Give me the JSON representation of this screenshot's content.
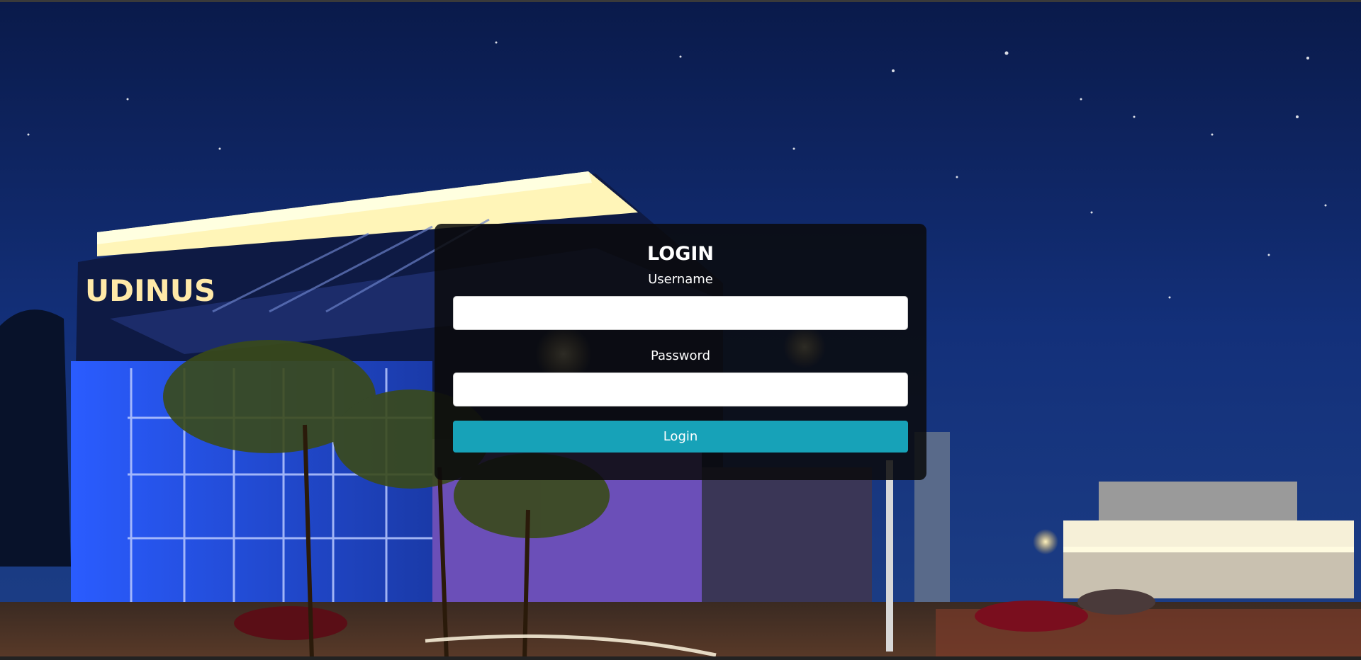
{
  "background": {
    "sky_color": "#0b1f55",
    "building_sign": "UDINUS"
  },
  "login": {
    "title": "LOGIN",
    "username_label": "Username",
    "username_value": "",
    "password_label": "Password",
    "password_value": "",
    "submit_label": "Login"
  },
  "colors": {
    "accent": "#17a2b8",
    "card_bg": "#0a0a0c"
  }
}
